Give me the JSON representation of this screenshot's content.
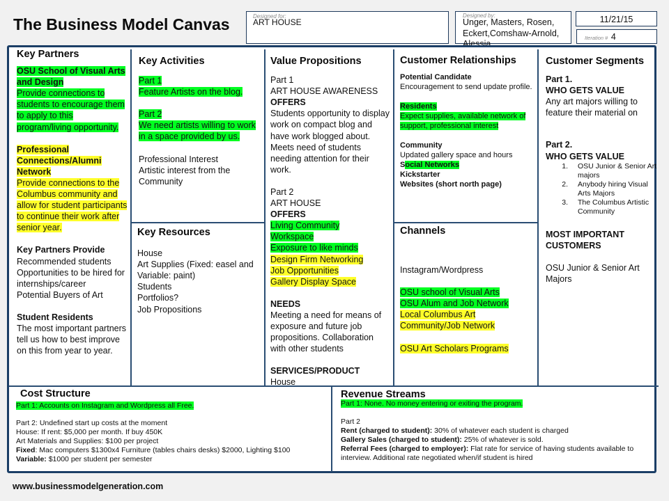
{
  "header": {
    "title": "The Business Model Canvas",
    "designed_for_label": "Designed for:",
    "designed_for": "ART HOUSE",
    "designed_by_label": "Designed by:",
    "designed_by": "Unger, Masters, Rosen, Eckert,Comshaw-Arnold, Alessia",
    "date": "11/21/15",
    "iteration_label": "Iteration #",
    "iteration": "4"
  },
  "key_partners": {
    "title": "Key Partners",
    "osu_title": "OSU School of Visual Arts and Design",
    "osu_body": "Provide connections to students to encourage them to apply to this program/living opportunity.",
    "pro_title": "Professional Connections/Alumni Network",
    "pro_body": "Provide connections to the Columbus community and allow for student participants to continue their work after senior year.",
    "provide_title": "Key Partners Provide",
    "provide_items": [
      "Recommended students",
      "Opportunities to be hired for internships/career",
      "Potential Buyers of Art"
    ],
    "residents_title": "Student Residents",
    "residents_body": "The most important partners tell us how to best improve on this from year to year."
  },
  "key_activities": {
    "title": "Key Activities",
    "part1_label": "Part 1",
    "part1_body": "Feature Artists on the blog.",
    "part2_label": "Part 2",
    "part2_body": "We need artists willing to work in a space provided by us.",
    "extra": [
      "Professional Interest",
      "Artistic interest from the Community"
    ]
  },
  "key_resources": {
    "title": "Key Resources",
    "items": [
      "House",
      "Art Supplies (Fixed: easel and Variable: paint)",
      "Students",
      "Portfolios?",
      "Job Propositions"
    ]
  },
  "value_propositions": {
    "title": "Value Propositions",
    "part1_label": "Part 1",
    "part1_name": "ART HOUSE AWARENESS",
    "offers_label": "OFFERS",
    "part1_body": "Students opportunity to display work on compact blog and have work blogged about. Meets need of students needing attention for their work.",
    "part2_label": "Part 2",
    "part2_name": "ART HOUSE",
    "offers_green": [
      "Living Community",
      "Workspace",
      "Exposure to like minds"
    ],
    "offers_yellow": [
      "Design Firm Networking",
      "Job Opportunities",
      "Gallery Display Space"
    ],
    "needs_label": "NEEDS",
    "needs_body": "Meeting a need for means of exposure and future job propositions.  Collaboration with other students",
    "services_label": "SERVICES/PRODUCT",
    "services_body": "House"
  },
  "customer_relationships": {
    "title": "Customer Relationships",
    "candidate_title": "Potential Candidate",
    "candidate_body": "Encouragement to send update profile.",
    "residents_title": "Residents",
    "residents_body": "Expect supplies, available network of support, professional interest",
    "community_title": "Community",
    "community_body": "Updated gallery space and hours",
    "social_s": "S",
    "social_rest": "ocial Networks",
    "kickstarter": "Kickstarter",
    "websites": "Websites (short north page)"
  },
  "channels": {
    "title": "Channels",
    "instagram": "Instagram/Wordpress",
    "green": [
      "OSU school of Visual Arts",
      "OSU Alum and Job Network"
    ],
    "yellow": [
      "Local Columbus Art Community/Job Network"
    ],
    "scholars": "OSU Art Scholars Programs"
  },
  "customer_segments": {
    "title": "Customer Segments",
    "part1_label": "Part 1.",
    "who_label": "WHO GETS VALUE",
    "part1_body": "Any art majors willing to feature their material on",
    "part2_label": "Part 2.",
    "part2_list": [
      {
        "num": "1.",
        "text": "OSU Junior & Senior Art majors"
      },
      {
        "num": "2.",
        "text": "Anybody hiring Visual Arts Majors"
      },
      {
        "num": "3.",
        "text": "The Columbus Artistic Community"
      }
    ],
    "most_important_label": "MOST IMPORTANT CUSTOMERS",
    "most_important_body": "OSU Junior & Senior Art Majors"
  },
  "cost_structure": {
    "title": "Cost Structure",
    "part1": "Part 1: Accounts on Instagram and Wordpress all Free.",
    "part2": "Part 2: Undefined start up costs at the moment",
    "house": "House: If rent: $5,000 per month.  If buy 450K",
    "materials": "Art Materials and Supplies: $100 per project",
    "fixed_label": "Fixed",
    "fixed_body": ": Mac computers $1300x4 Furniture (tables chairs desks) $2000, Lighting $100",
    "variable_label": "Variable:",
    "variable_body": " $1000 per student per semester"
  },
  "revenue_streams": {
    "title": "Revenue Streams",
    "part1": "Part 1: None.  No money entering or exiting the program.",
    "part2": "Part 2",
    "rent_label": "Rent (charged to student):",
    "rent_body": " 30% of whatever each student is charged",
    "gallery_label": "Gallery Sales (charged to student):",
    "gallery_body": " 25% of whatever is sold.",
    "referral_label": "Referral Fees (charged to employer):",
    "referral_body": " Flat rate for service of having students available to interview.  Additional rate negotiated when/if student is hired"
  },
  "footer": {
    "url": "www.businessmodelgeneration.com"
  },
  "colors": {
    "highlight_green": "#00ff21",
    "highlight_yellow": "#ffff2a",
    "frame": "#1b3e66"
  }
}
